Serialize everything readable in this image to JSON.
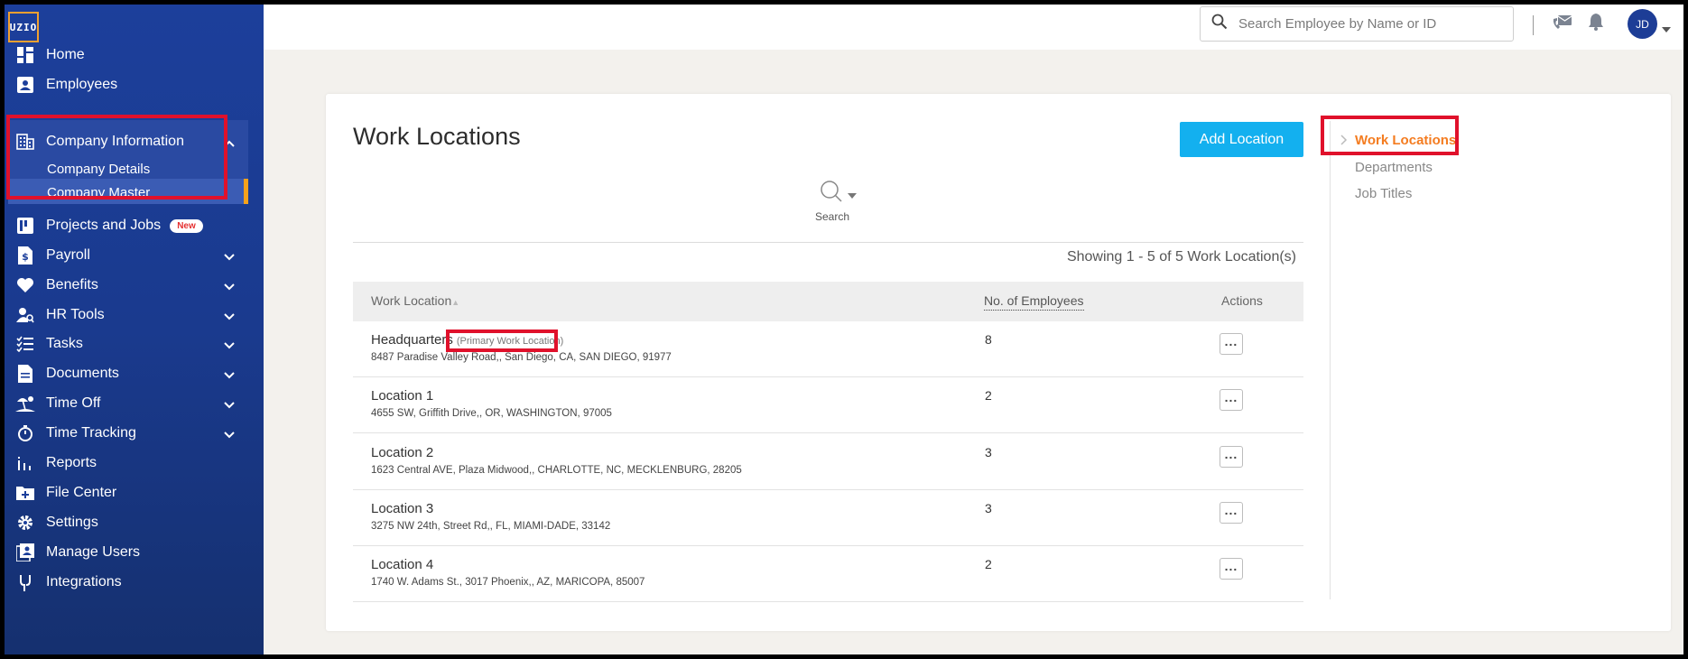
{
  "logo": "UZIO",
  "sidebar": {
    "items": [
      {
        "label": "Home",
        "icon": "dashboard-icon"
      },
      {
        "label": "Employees",
        "icon": "person-badge-icon"
      },
      {
        "label": "Company Information",
        "icon": "building-icon"
      },
      {
        "label": "Projects and Jobs",
        "icon": "board-icon",
        "badge": "New"
      },
      {
        "label": "Payroll",
        "icon": "dollar-doc-icon"
      },
      {
        "label": "Benefits",
        "icon": "heart-icon"
      },
      {
        "label": "HR Tools",
        "icon": "user-search-icon"
      },
      {
        "label": "Tasks",
        "icon": "checklist-icon"
      },
      {
        "label": "Documents",
        "icon": "document-icon"
      },
      {
        "label": "Time Off",
        "icon": "beach-icon"
      },
      {
        "label": "Time Tracking",
        "icon": "stopwatch-icon"
      },
      {
        "label": "Reports",
        "icon": "bar-chart-icon"
      },
      {
        "label": "File Center",
        "icon": "folder-plus-icon"
      },
      {
        "label": "Settings",
        "icon": "gear-icon"
      },
      {
        "label": "Manage Users",
        "icon": "users-icon"
      },
      {
        "label": "Integrations",
        "icon": "plug-icon"
      }
    ],
    "company_sub": [
      "Company Details",
      "Company Master"
    ],
    "accent": "#f7a21b"
  },
  "topbar": {
    "search_placeholder": "Search Employee by Name or ID",
    "avatar_initials": "JD"
  },
  "main": {
    "title": "Work Locations",
    "add_button": "Add Location",
    "search_label": "Search",
    "showing": "Showing 1 - 5 of 5 Work Location(s)",
    "columns": [
      "Work Location",
      "No. of Employees",
      "Actions"
    ],
    "rows": [
      {
        "name": "Headquarters",
        "tag": "(Primary Work Location)",
        "address": "8487 Paradise Valley Road,, San Diego, CA, SAN DIEGO, 91977",
        "employees": "8"
      },
      {
        "name": "Location 1",
        "tag": "",
        "address": "4655 SW, Griffith Drive,, OR, WASHINGTON, 97005",
        "employees": "2"
      },
      {
        "name": "Location 2",
        "tag": "",
        "address": "1623 Central AVE, Plaza Midwood,, CHARLOTTE, NC, MECKLENBURG, 28205",
        "employees": "3"
      },
      {
        "name": "Location 3",
        "tag": "",
        "address": "3275 NW 24th, Street Rd,, FL, MIAMI-DADE, 33142",
        "employees": "3"
      },
      {
        "name": "Location 4",
        "tag": "",
        "address": "1740 W. Adams St., 3017 Phoenix,, AZ, MARICOPA, 85007",
        "employees": "2"
      }
    ],
    "actions_glyph": "..."
  },
  "right_nav": {
    "items": [
      "Work Locations",
      "Departments",
      "Job Titles"
    ],
    "active_color": "#f47c20"
  }
}
